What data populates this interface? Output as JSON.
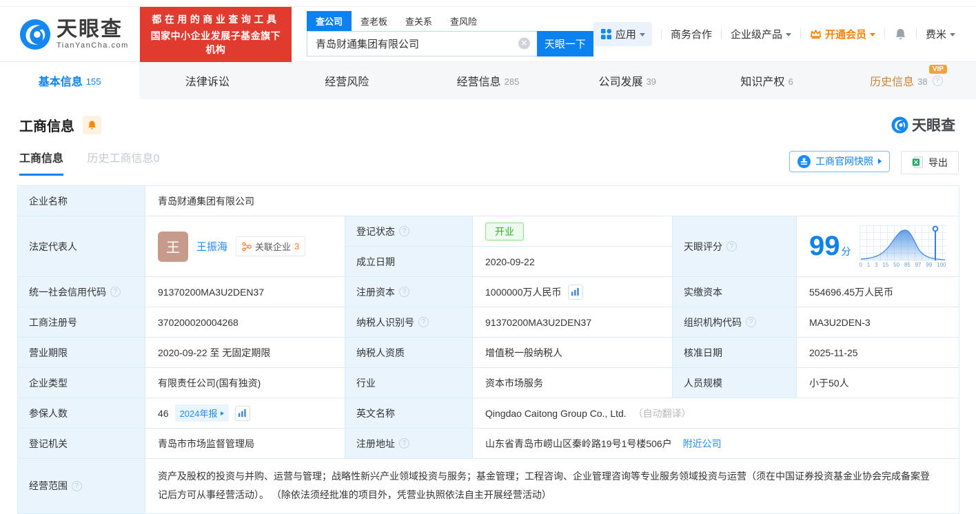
{
  "header": {
    "brand": "天眼查",
    "brand_domain": "TianYanCha.com",
    "banner_line1": "都在用的商业查询工具",
    "banner_line2": "国家中小企业发展子基金旗下机构",
    "search_tabs": [
      {
        "label": "查公司"
      },
      {
        "label": "查老板"
      },
      {
        "label": "查关系"
      },
      {
        "label": "查风险"
      }
    ],
    "search_value": "青岛财通集团有限公司",
    "search_button": "天眼一下",
    "nav_apps": "应用",
    "nav_cooperation": "商务合作",
    "nav_enterprise": "企业级产品",
    "nav_vip": "开通会员",
    "nav_user": "费米"
  },
  "nav_tabs": [
    {
      "label": "基本信息",
      "count": "155"
    },
    {
      "label": "法律诉讼",
      "count": ""
    },
    {
      "label": "经营风险",
      "count": ""
    },
    {
      "label": "经营信息",
      "count": "285"
    },
    {
      "label": "公司发展",
      "count": "39"
    },
    {
      "label": "知识产权",
      "count": "6"
    },
    {
      "label": "历史信息",
      "count": "38",
      "vip": "VIP"
    }
  ],
  "section": {
    "title": "工商信息",
    "watermark": "天眼查",
    "subtab_active": "工商信息",
    "subtab_history": "历史工商信息0",
    "snapshot_button": "工商官网快照",
    "export_button": "导出"
  },
  "fields": {
    "company_name_label": "企业名称",
    "company_name": "青岛财通集团有限公司",
    "legal_rep_label": "法定代表人",
    "legal_rep_avatar": "王",
    "legal_rep_name": "王振海",
    "related_company_label": "关联企业",
    "related_company_count": "3",
    "reg_status_label": "登记状态",
    "reg_status": "开业",
    "establish_date_label": "成立日期",
    "establish_date": "2020-09-22",
    "score_label": "天眼评分",
    "score_value": "99",
    "score_unit": "分",
    "credit_code_label": "统一社会信用代码",
    "credit_code": "91370200MA3U2DEN37",
    "reg_capital_label": "注册资本",
    "reg_capital": "1000000万人民币",
    "paid_capital_label": "实缴资本",
    "paid_capital": "554696.45万人民币",
    "reg_number_label": "工商注册号",
    "reg_number": "370200020004268",
    "taxpayer_id_label": "纳税人识别号",
    "taxpayer_id": "91370200MA3U2DEN37",
    "org_code_label": "组织机构代码",
    "org_code": "MA3U2DEN-3",
    "business_term_label": "营业期限",
    "business_term": "2020-09-22 至 无固定期限",
    "taxpayer_quality_label": "纳税人资质",
    "taxpayer_quality": "增值税一般纳税人",
    "approval_date_label": "核准日期",
    "approval_date": "2025-11-25",
    "company_type_label": "企业类型",
    "company_type": "有限责任公司(国有独资)",
    "industry_label": "行业",
    "industry": "资本市场服务",
    "staff_size_label": "人员规模",
    "staff_size": "小于50人",
    "insured_label": "参保人数",
    "insured_count": "46",
    "insured_report": "2024年报",
    "english_name_label": "英文名称",
    "english_name": "Qingdao Caitong Group Co., Ltd.",
    "english_name_note": "（自动翻译）",
    "reg_authority_label": "登记机关",
    "reg_authority": "青岛市市场监督管理局",
    "reg_address_label": "注册地址",
    "reg_address": "山东省青岛市崂山区秦岭路19号1号楼506户",
    "nearby_link": "附近公司",
    "business_scope_label": "经营范围",
    "business_scope": "资产及股权的投资与并购、运营与管理；战略性新兴产业领域投资与服务；基金管理；工程咨询、企业管理咨询等专业服务领域投资与运营（须在中国证券投资基金业协会完成备案登记后方可从事经营活动）。 （除依法须经批准的项目外，凭营业执照依法自主开展经营活动）"
  },
  "score_chart": {
    "type": "area",
    "ticks": [
      "0",
      "1",
      "3",
      "15",
      "50",
      "85",
      "97",
      "99",
      "100"
    ],
    "marker_value": "99",
    "color": "#4a90e2"
  }
}
